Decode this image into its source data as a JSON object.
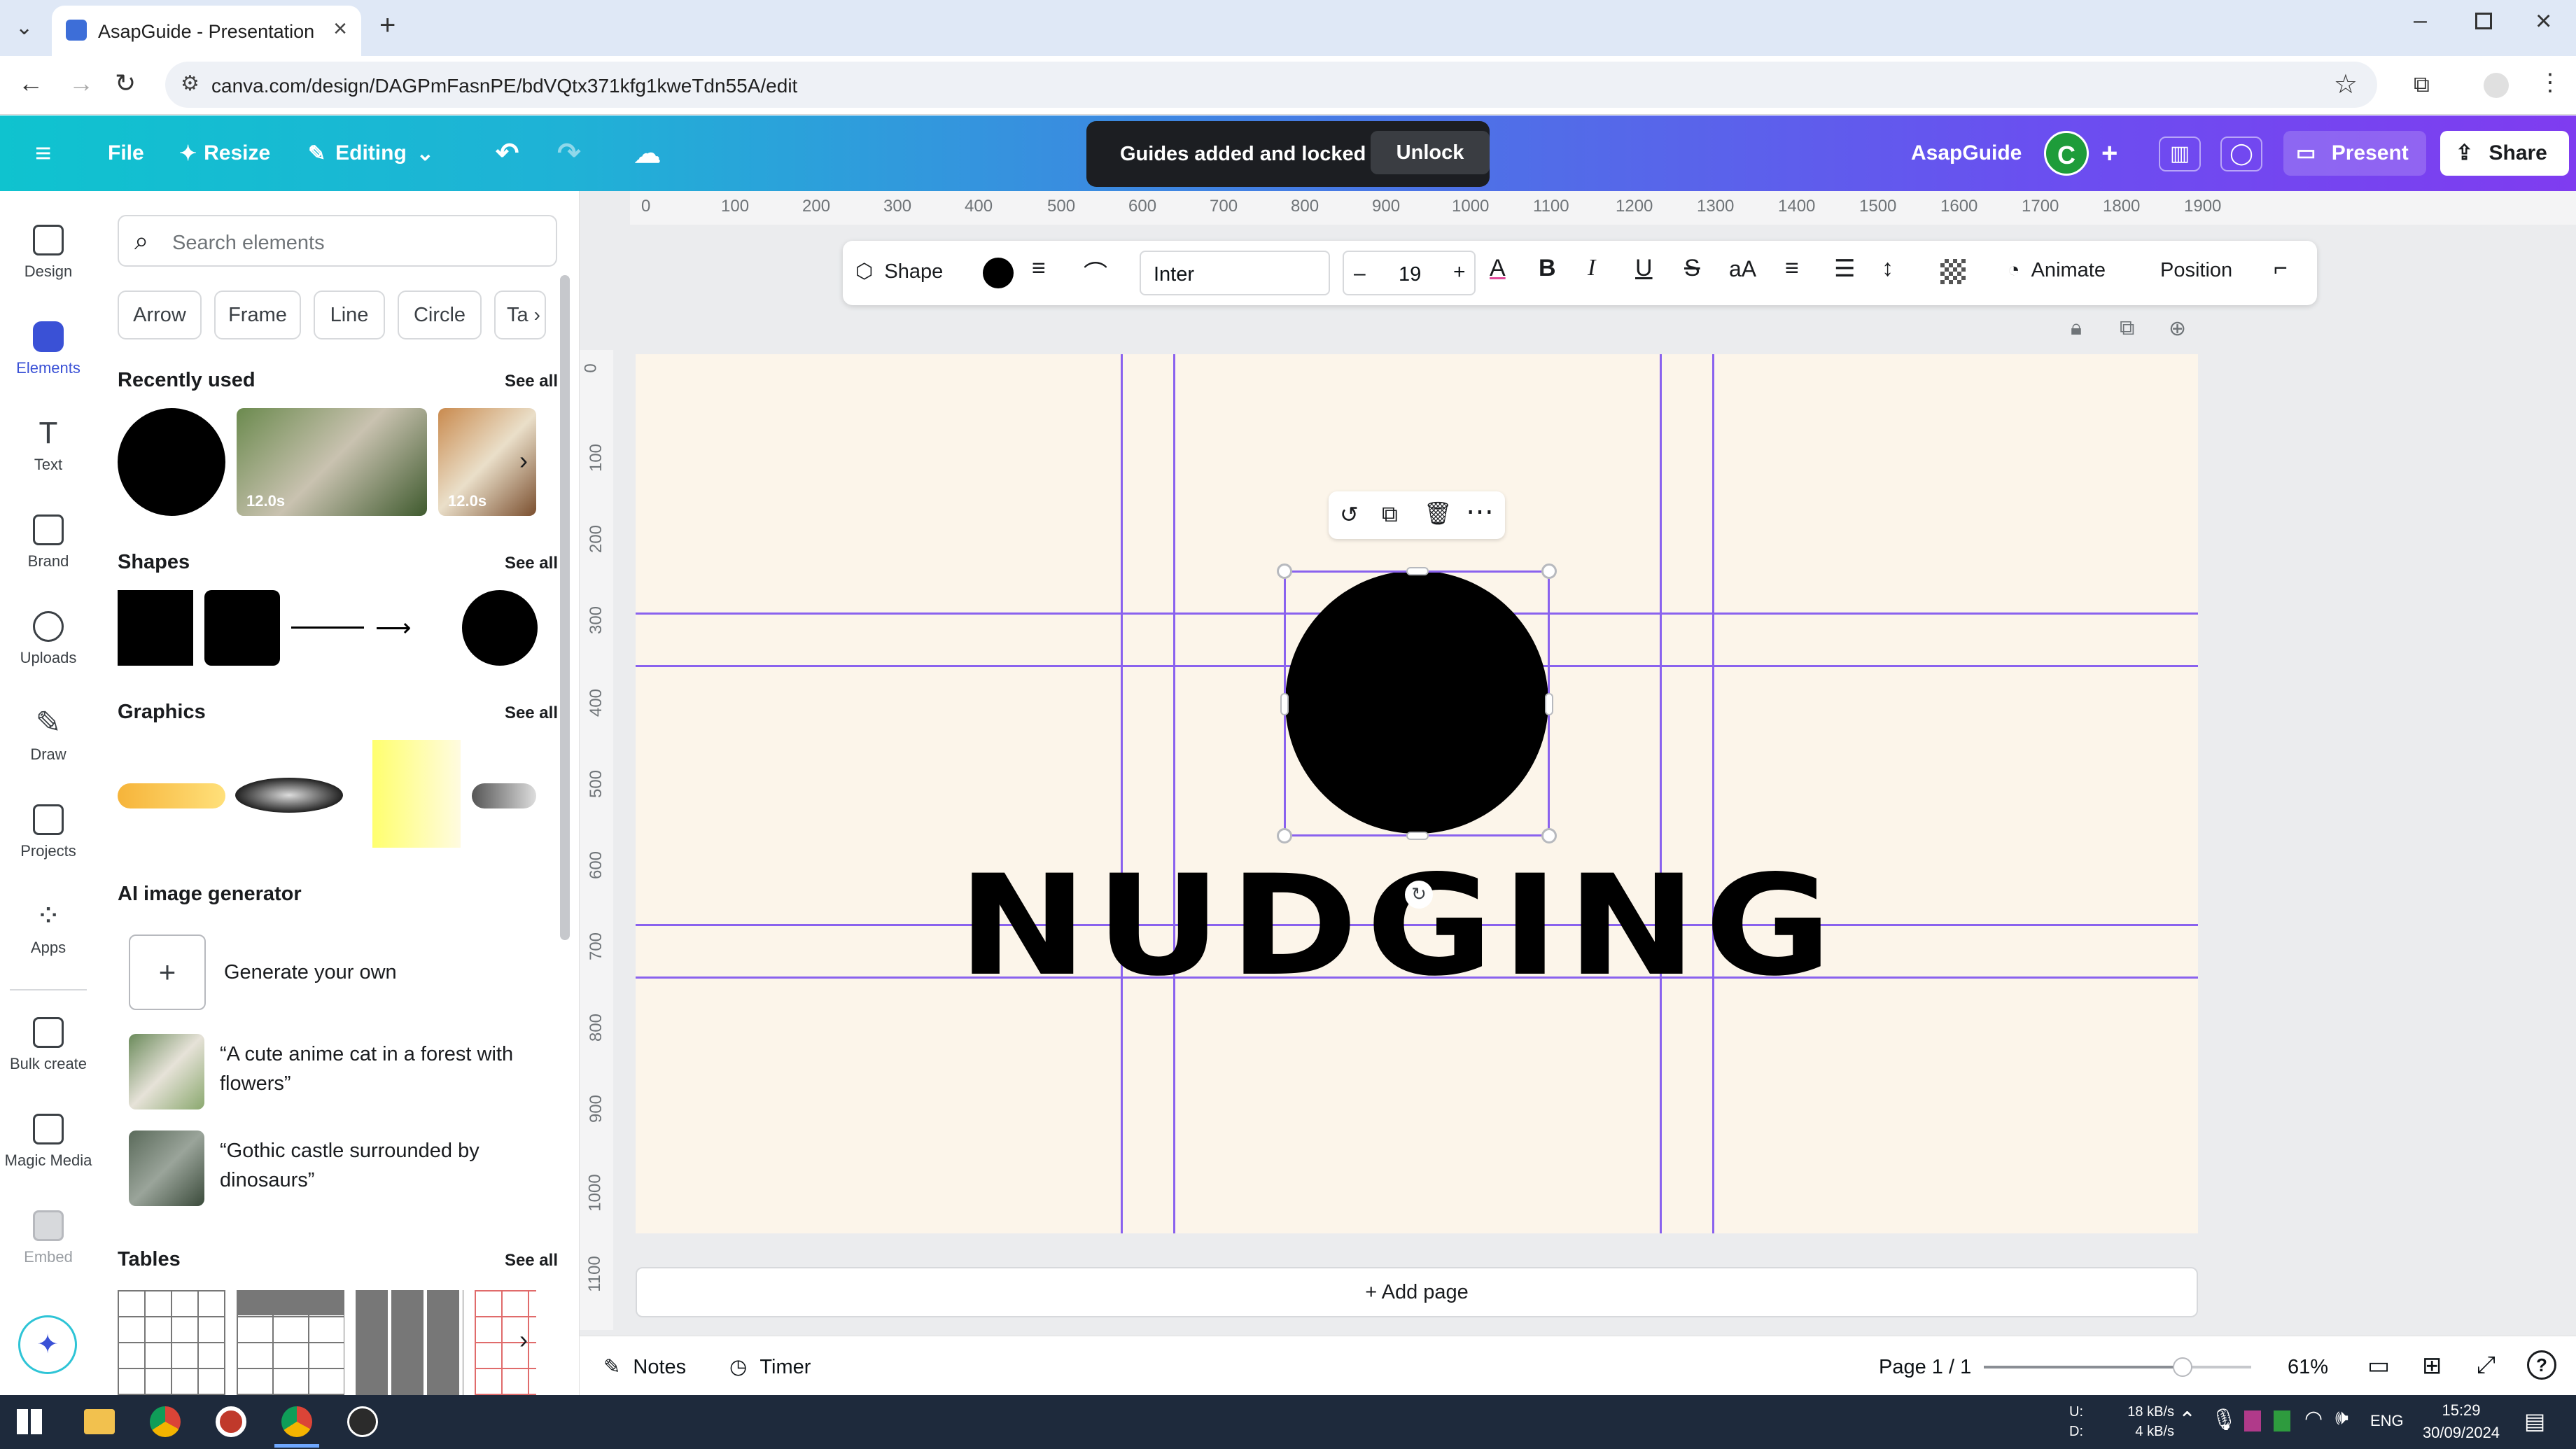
{
  "browser": {
    "tab_title": "AsapGuide - Presentation",
    "url": "canva.com/design/DAGPmFasnPE/bdVQtx371kfg1kweTdn55A/edit"
  },
  "header": {
    "file": "File",
    "resize": "Resize",
    "editing": "Editing",
    "toast_message": "Guides added and locked",
    "toast_action": "Unlock",
    "team_name": "AsapGuide",
    "avatar_letter": "C",
    "present": "Present",
    "share": "Share"
  },
  "rail": {
    "items": [
      {
        "label": "Design"
      },
      {
        "label": "Elements"
      },
      {
        "label": "Text"
      },
      {
        "label": "Brand"
      },
      {
        "label": "Uploads"
      },
      {
        "label": "Draw"
      },
      {
        "label": "Projects"
      },
      {
        "label": "Apps"
      },
      {
        "label": "Bulk create"
      },
      {
        "label": "Magic Media"
      },
      {
        "label": "Embed"
      }
    ]
  },
  "panel": {
    "search_placeholder": "Search elements",
    "chips": [
      "Arrow",
      "Frame",
      "Line",
      "Circle",
      "Ta"
    ],
    "recently_used": "Recently used",
    "see_all": "See all",
    "video_duration_1": "12.0s",
    "video_duration_2": "12.0s",
    "shapes": "Shapes",
    "graphics": "Graphics",
    "ai_generator": "AI image generator",
    "generate_your_own": "Generate your own",
    "prompt_1": "“A cute anime cat in a forest with flowers”",
    "prompt_2": "“Gothic castle surrounded by dinosaurs”",
    "tables": "Tables"
  },
  "ruler": {
    "horizontal": [
      "0",
      "100",
      "200",
      "300",
      "400",
      "500",
      "600",
      "700",
      "800",
      "900",
      "1000",
      "1100",
      "1200",
      "1300",
      "1400",
      "1500",
      "1600",
      "1700",
      "1800",
      "1900"
    ],
    "vertical": [
      "0",
      "100",
      "200",
      "300",
      "400",
      "500",
      "600",
      "700",
      "800",
      "900",
      "1000",
      "1100"
    ]
  },
  "context_toolbar": {
    "shape": "Shape",
    "font": "Inter",
    "font_size": "19",
    "minus": "–",
    "plus": "+",
    "animate": "Animate",
    "position": "Position"
  },
  "canvas": {
    "background_color": "#fcf5ea",
    "text": "NUDGING",
    "add_page": "+ Add page"
  },
  "footer": {
    "notes": "Notes",
    "timer": "Timer",
    "page_indicator": "Page 1 / 1",
    "zoom": "61%",
    "zoom_fraction": 0.61
  },
  "taskbar": {
    "net_up": "18 kB/s",
    "net_down": "4 kB/s",
    "net_u": "U:",
    "net_d": "D:",
    "lang": "ENG",
    "time": "15:29",
    "date": "30/09/2024"
  },
  "colors": {
    "accent": "#8a62ee",
    "header_start": "#0fc3cf",
    "header_end": "#7f3cf0",
    "avatar": "#1e9c3a"
  }
}
